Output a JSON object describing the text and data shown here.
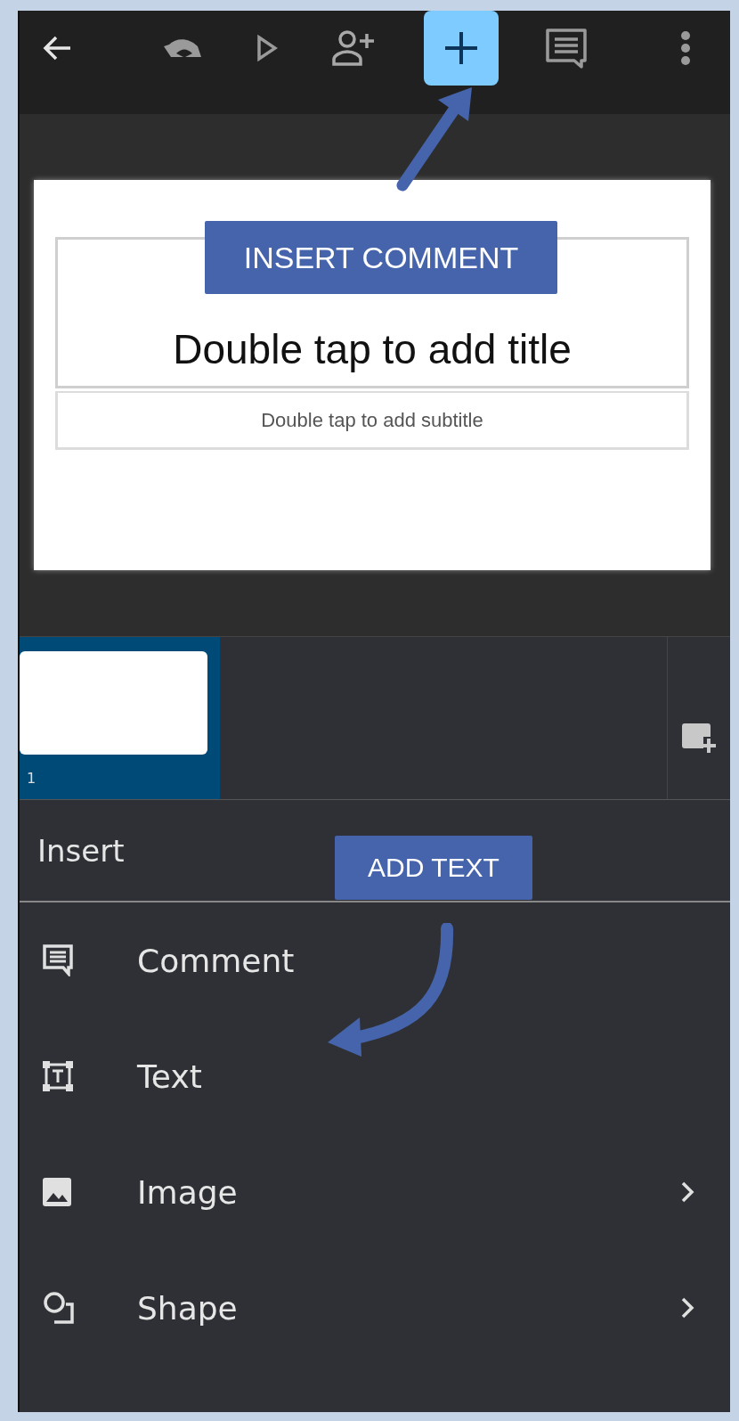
{
  "toolbar": [
    {
      "kind": "back",
      "selected": false
    },
    {
      "kind": "undo",
      "selected": false
    },
    {
      "kind": "present",
      "selected": false
    },
    {
      "kind": "share",
      "selected": false
    },
    {
      "kind": "insert",
      "selected": true
    },
    {
      "kind": "comments",
      "selected": false
    },
    {
      "kind": "more",
      "selected": false
    }
  ],
  "slide": {
    "title_placeholder": "Double tap to add title",
    "subtitle_placeholder": "Double tap to add subtitle"
  },
  "filmstrip": {
    "slides": [
      {
        "number": "1",
        "selected": true
      }
    ]
  },
  "insert_panel": {
    "title": "Insert",
    "items": [
      {
        "kind": "comment",
        "label": "Comment",
        "submenu": false
      },
      {
        "kind": "text",
        "label": "Text",
        "submenu": false
      },
      {
        "kind": "image",
        "label": "Image",
        "submenu": true
      },
      {
        "kind": "shape",
        "label": "Shape",
        "submenu": true
      }
    ]
  },
  "annotations": [
    {
      "kind": "insert",
      "text": "INSERT COMMENT"
    },
    {
      "kind": "add-text",
      "text": "ADD TEXT"
    }
  ]
}
